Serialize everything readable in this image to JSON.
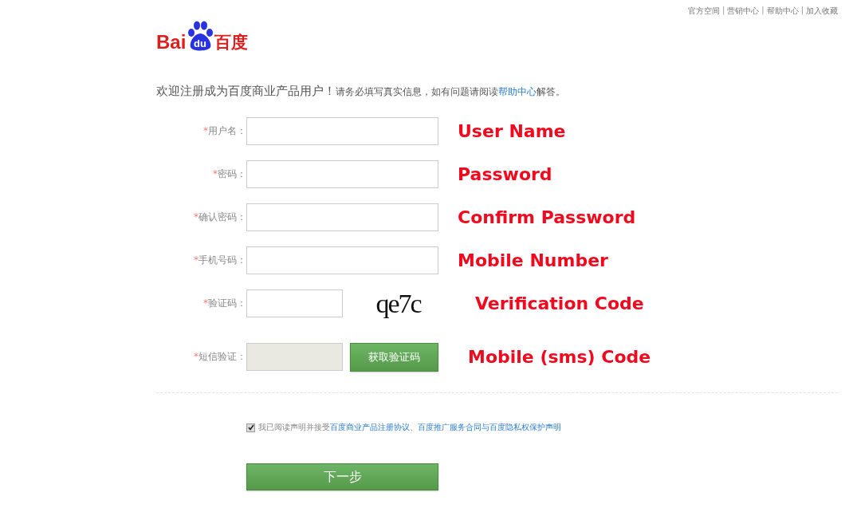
{
  "top_links": [
    "官方空间",
    "营销中心",
    "帮助中心",
    "加入收藏"
  ],
  "top_separator": "|",
  "logo": {
    "left": "Bai",
    "paw": "du",
    "right": "百度"
  },
  "intro": {
    "heading": "欢迎注册成为百度商业产品用户！",
    "note_before": "请务必填写真实信息，如有问题请阅读",
    "note_link": "帮助中心",
    "note_after": "解答。"
  },
  "fields": [
    {
      "kind": "text",
      "label": "用户名：",
      "required_mark": "*",
      "annotation": "User Name",
      "disabled": false
    },
    {
      "kind": "text",
      "label": "密码：",
      "required_mark": "*",
      "annotation": "Password",
      "disabled": false
    },
    {
      "kind": "text",
      "label": "确认密码：",
      "required_mark": "*",
      "annotation": "Confirm Password",
      "disabled": false
    },
    {
      "kind": "text",
      "label": "手机号码：",
      "required_mark": "*",
      "annotation": "Mobile Number",
      "disabled": false
    },
    {
      "kind": "captcha",
      "label": "验证码：",
      "required_mark": "*",
      "annotation": "Verification Code",
      "disabled": false,
      "captcha": "qe7c"
    },
    {
      "kind": "sms",
      "label": "短信验证：",
      "required_mark": "*",
      "annotation": "Mobile (sms) Code",
      "disabled": true,
      "button": "获取验证码"
    }
  ],
  "agreement": {
    "checked": true,
    "text": "我已阅读声明并接受",
    "links": [
      "百度商业产品注册协议",
      "百度推广服务合同",
      "百度隐私权保护声明"
    ],
    "separators": [
      "、",
      "与"
    ]
  },
  "next_button": "下一步"
}
